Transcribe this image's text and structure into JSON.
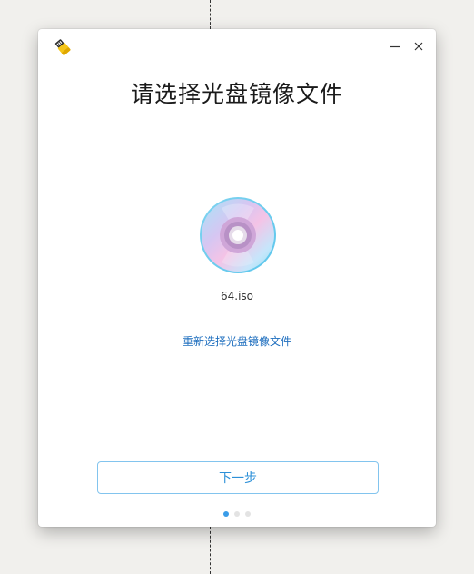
{
  "window": {
    "title": "请选择光盘镜像文件",
    "minimize_icon": "minimize-icon",
    "close_icon": "close-icon",
    "app_icon": "usb-drive-icon"
  },
  "content": {
    "disc_icon": "disc-icon",
    "file_name": "64.iso",
    "reselect_link": "重新选择光盘镜像文件"
  },
  "footer": {
    "next_button": "下一步",
    "step_indicator": {
      "total": 3,
      "current": 1
    }
  },
  "colors": {
    "accent": "#2d90d8",
    "link": "#1f6fbf",
    "button_border": "#82c4ee",
    "desktop_bg": "#f1f0ed"
  }
}
